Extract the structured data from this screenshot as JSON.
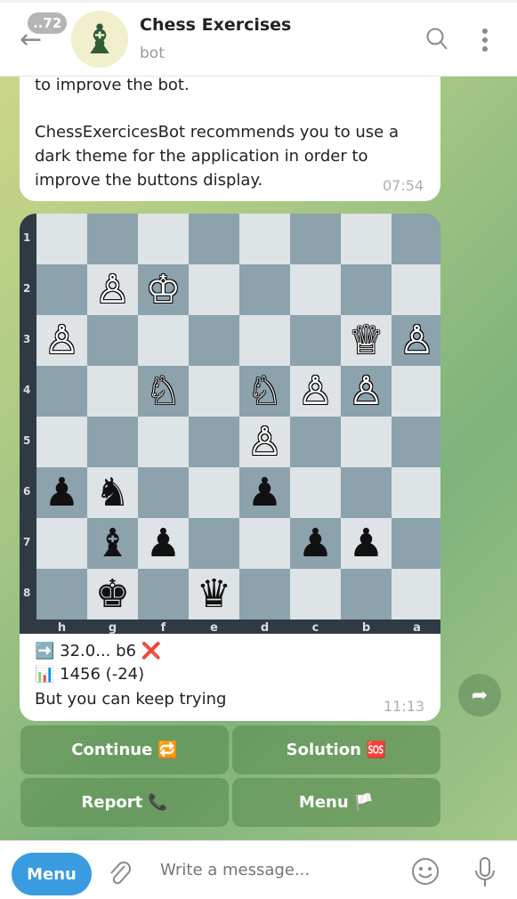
{
  "header": {
    "back_badge": "..72",
    "title": "Chess Exercises",
    "subtitle": "bot",
    "avatar": "♝"
  },
  "message1": {
    "lines": [
      "to improve the bot.",
      "",
      "ChessExercicesBot recommends you to use a",
      "dark theme for the application in order to",
      "improve the buttons display."
    ],
    "time": "07:54"
  },
  "board": {
    "ranks": [
      "1",
      "2",
      "3",
      "4",
      "5",
      "6",
      "7",
      "8"
    ],
    "files": [
      "h",
      "g",
      "f",
      "e",
      "d",
      "c",
      "b",
      "a"
    ],
    "colors": {
      "light": "#dee3e6",
      "dark": "#8ca2ad"
    },
    "pieces": [
      {
        "sq": "g2",
        "p": "♙",
        "c": "w"
      },
      {
        "sq": "f2",
        "p": "♔",
        "c": "w"
      },
      {
        "sq": "h3",
        "p": "♙",
        "c": "w"
      },
      {
        "sq": "b3",
        "p": "♕",
        "c": "w"
      },
      {
        "sq": "a3",
        "p": "♙",
        "c": "w"
      },
      {
        "sq": "f4",
        "p": "♘",
        "c": "w"
      },
      {
        "sq": "d4",
        "p": "♘",
        "c": "w"
      },
      {
        "sq": "c4",
        "p": "♙",
        "c": "w"
      },
      {
        "sq": "b4",
        "p": "♙",
        "c": "w"
      },
      {
        "sq": "d5",
        "p": "♙",
        "c": "w"
      },
      {
        "sq": "h6",
        "p": "♟",
        "c": "k"
      },
      {
        "sq": "g6",
        "p": "♞",
        "c": "k"
      },
      {
        "sq": "d6",
        "p": "♟",
        "c": "k"
      },
      {
        "sq": "g7",
        "p": "♝",
        "c": "k"
      },
      {
        "sq": "f7",
        "p": "♟",
        "c": "k"
      },
      {
        "sq": "c7",
        "p": "♟",
        "c": "k"
      },
      {
        "sq": "b7",
        "p": "♟",
        "c": "k"
      },
      {
        "sq": "g8",
        "p": "♚",
        "c": "k"
      },
      {
        "sq": "e8",
        "p": "♛",
        "c": "k"
      }
    ]
  },
  "message2": {
    "move_icon": "➡️",
    "move": "32.0... b6",
    "wrong_icon": "❌",
    "rating_icon": "📊",
    "rating": "1456 (-24)",
    "note": "But you can keep trying",
    "time": "11:13"
  },
  "keyboard": [
    {
      "label": "Continue",
      "icon": "🔁"
    },
    {
      "label": "Solution",
      "icon": "🆘"
    },
    {
      "label": "Report",
      "icon": "📞"
    },
    {
      "label": "Menu",
      "icon": "🏳️"
    }
  ],
  "footer": {
    "menu": "Menu",
    "placeholder": "Write a message..."
  }
}
